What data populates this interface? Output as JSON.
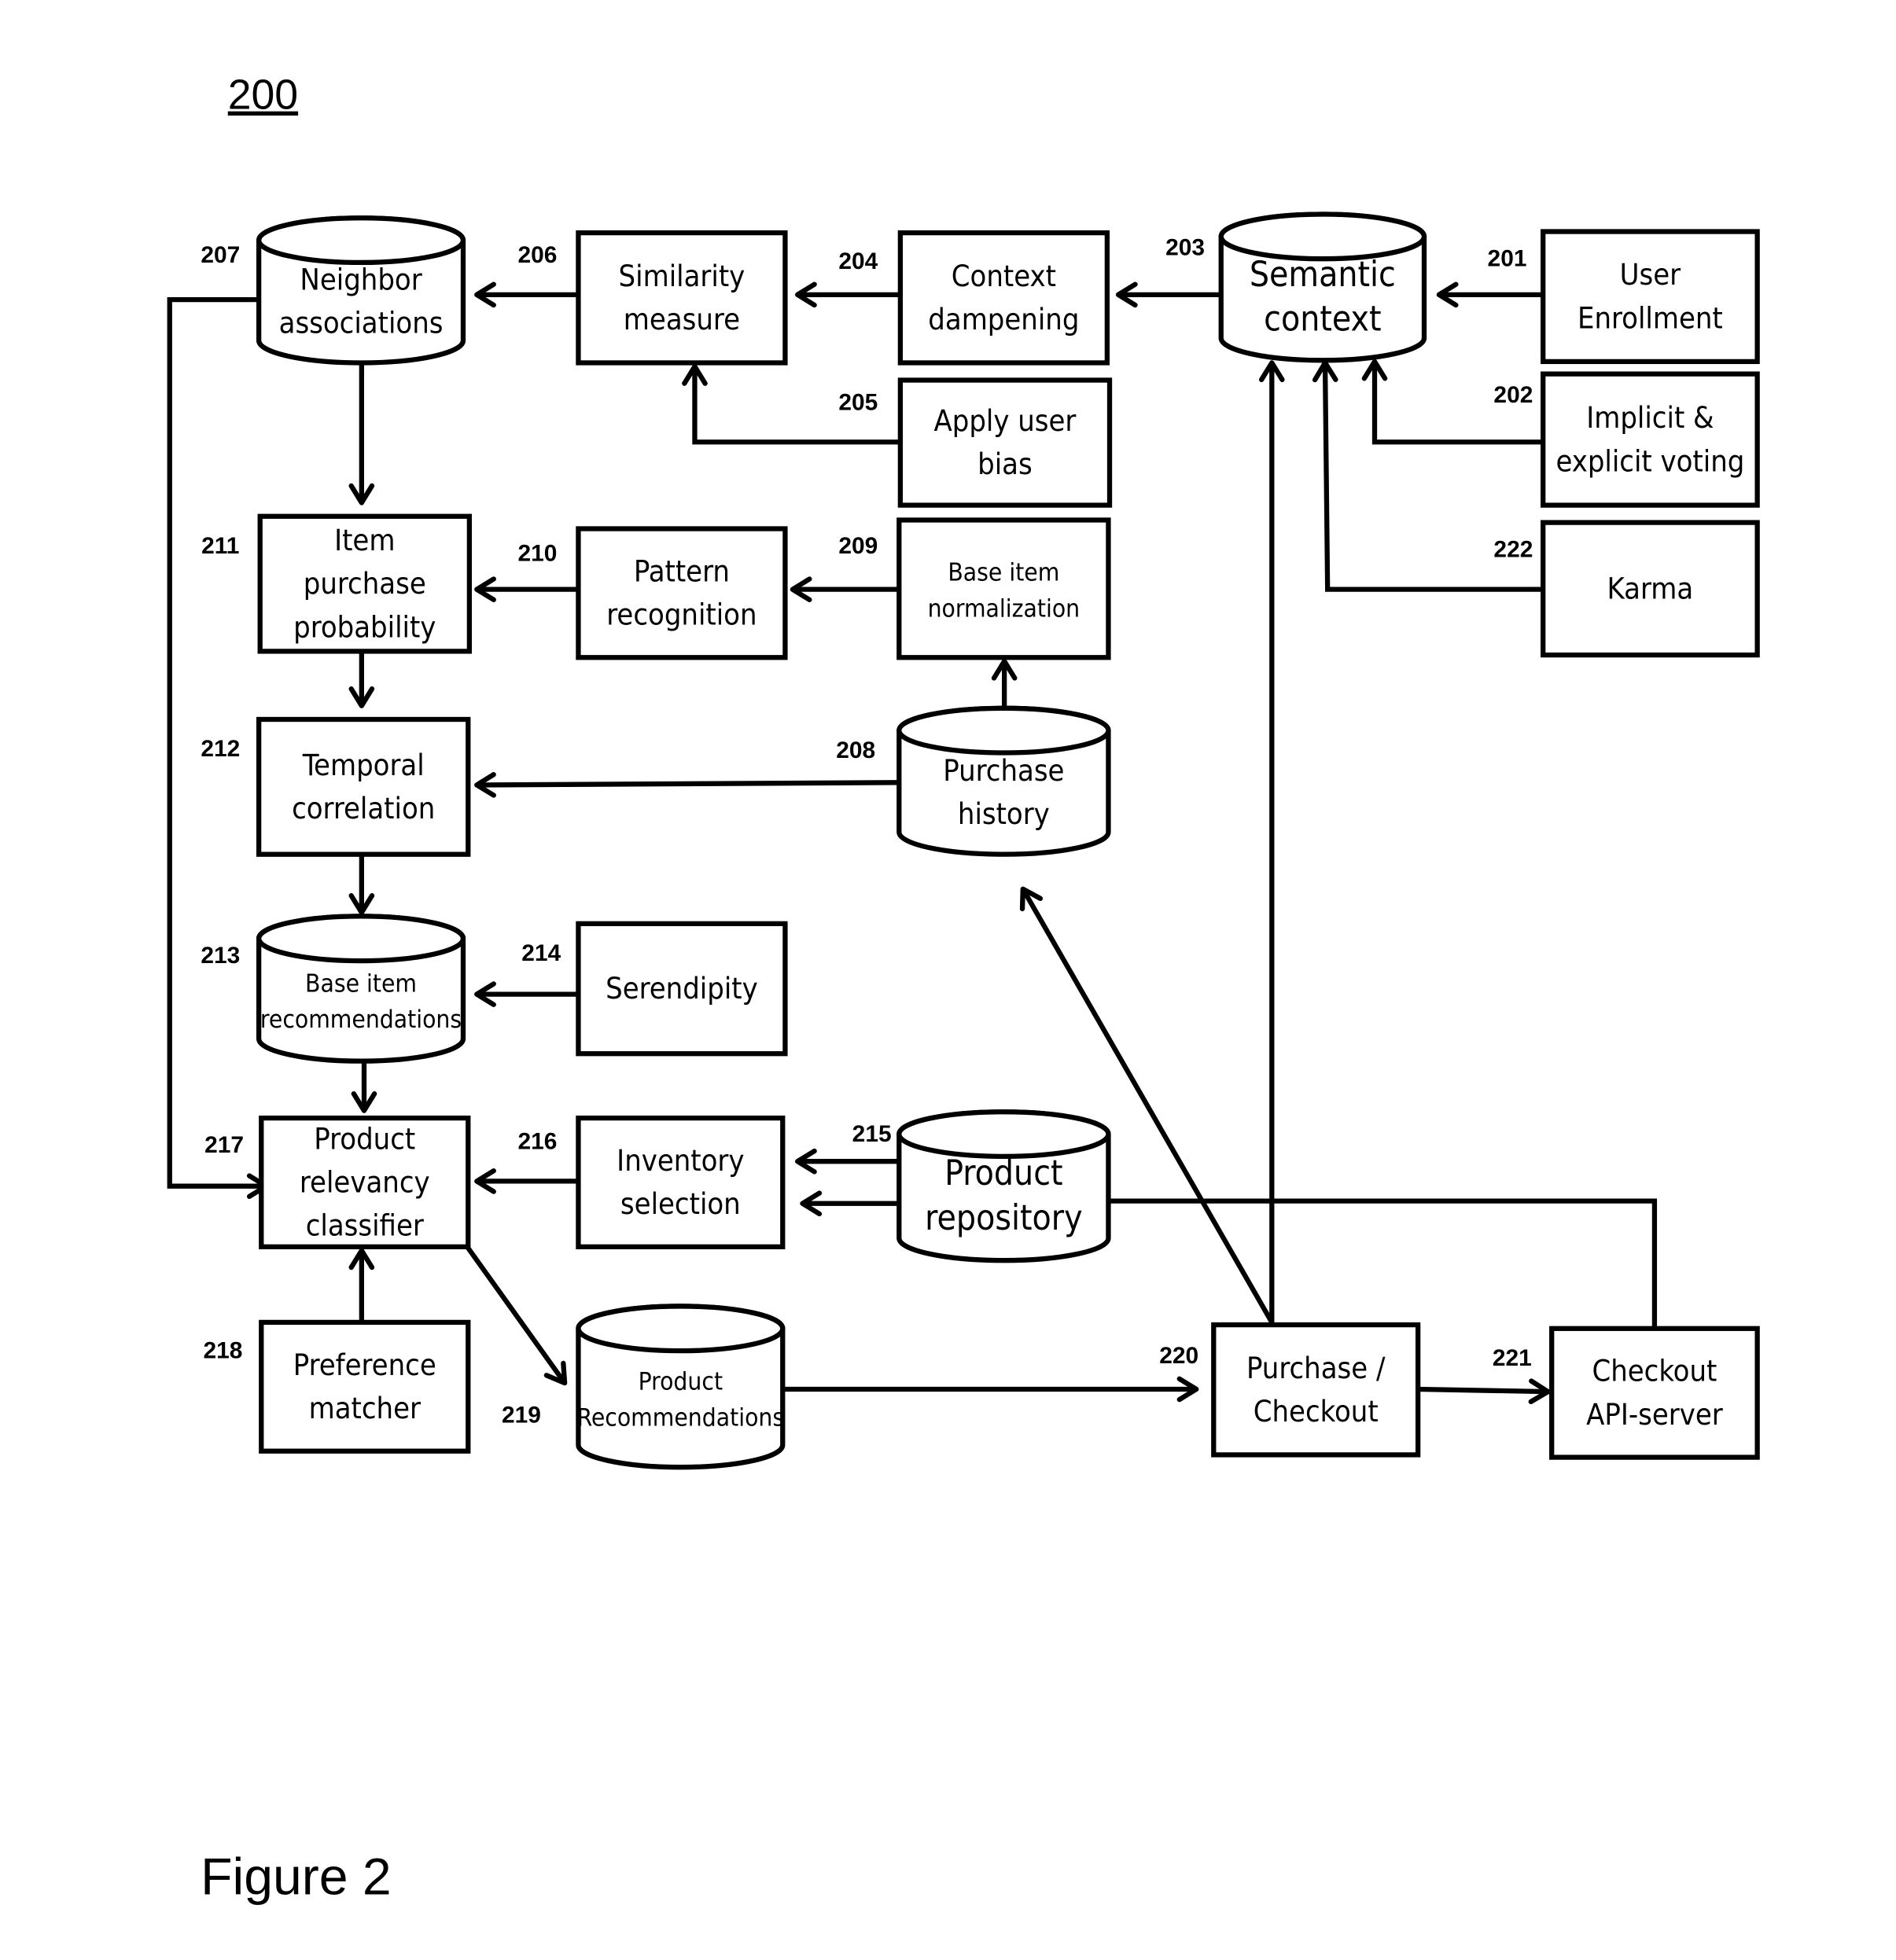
{
  "diagram": {
    "reference_number": "200",
    "figure_caption": "Figure 2",
    "nodes": {
      "n201": {
        "number": "201",
        "shape": "box",
        "lines": [
          "User",
          "Enrollment"
        ]
      },
      "n202": {
        "number": "202",
        "shape": "box",
        "lines": [
          "Implicit &",
          "explicit voting"
        ]
      },
      "n203": {
        "number": "203",
        "shape": "cylinder",
        "lines": [
          "Semantic",
          "context"
        ]
      },
      "n204": {
        "number": "204",
        "shape": "box",
        "lines": [
          "Context",
          "dampening"
        ]
      },
      "n205": {
        "number": "205",
        "shape": "box",
        "lines": [
          "Apply user",
          "bias"
        ]
      },
      "n206": {
        "number": "206",
        "shape": "box",
        "lines": [
          "Similarity",
          "measure"
        ]
      },
      "n207": {
        "number": "207",
        "shape": "cylinder",
        "lines": [
          "Neighbor",
          "associations"
        ]
      },
      "n208": {
        "number": "208",
        "shape": "cylinder",
        "lines": [
          "Purchase",
          "history"
        ]
      },
      "n209": {
        "number": "209",
        "shape": "box",
        "lines": [
          "Base item",
          "normalization"
        ]
      },
      "n210": {
        "number": "210",
        "shape": "box",
        "lines": [
          "Pattern",
          "recognition"
        ]
      },
      "n211": {
        "number": "211",
        "shape": "box",
        "lines": [
          "Item",
          "purchase",
          "probability"
        ]
      },
      "n212": {
        "number": "212",
        "shape": "box",
        "lines": [
          "Temporal",
          "correlation"
        ]
      },
      "n213": {
        "number": "213",
        "shape": "cylinder",
        "lines": [
          "Base item",
          "recommendations"
        ]
      },
      "n214": {
        "number": "214",
        "shape": "box",
        "lines": [
          "Serendipity"
        ]
      },
      "n215": {
        "number": "215",
        "shape": "cylinder",
        "lines": [
          "Product",
          "repository"
        ]
      },
      "n216": {
        "number": "216",
        "shape": "box",
        "lines": [
          "Inventory",
          "selection"
        ]
      },
      "n217": {
        "number": "217",
        "shape": "box",
        "lines": [
          "Product",
          "relevancy",
          "classifier"
        ]
      },
      "n218": {
        "number": "218",
        "shape": "box",
        "lines": [
          "Preference",
          "matcher"
        ]
      },
      "n219": {
        "number": "219",
        "shape": "cylinder",
        "lines": [
          "Product",
          "Recommendations"
        ]
      },
      "n220": {
        "number": "220",
        "shape": "box",
        "lines": [
          "Purchase /",
          "Checkout"
        ]
      },
      "n221": {
        "number": "221",
        "shape": "box",
        "lines": [
          "Checkout",
          "API-server"
        ]
      },
      "n222": {
        "number": "222",
        "shape": "box",
        "lines": [
          "Karma"
        ]
      }
    },
    "edges": [
      {
        "from": "201",
        "to": "203"
      },
      {
        "from": "202",
        "to": "203"
      },
      {
        "from": "222",
        "to": "203"
      },
      {
        "from": "220",
        "to": "203"
      },
      {
        "from": "203",
        "to": "204"
      },
      {
        "from": "204",
        "to": "206"
      },
      {
        "from": "205",
        "to": "206"
      },
      {
        "from": "206",
        "to": "207"
      },
      {
        "from": "207",
        "to": "211"
      },
      {
        "from": "207",
        "to": "217"
      },
      {
        "from": "208",
        "to": "209"
      },
      {
        "from": "208",
        "to": "212"
      },
      {
        "from": "209",
        "to": "210"
      },
      {
        "from": "210",
        "to": "211"
      },
      {
        "from": "211",
        "to": "212"
      },
      {
        "from": "212",
        "to": "213"
      },
      {
        "from": "214",
        "to": "213"
      },
      {
        "from": "213",
        "to": "217"
      },
      {
        "from": "215",
        "to": "216"
      },
      {
        "from": "221",
        "to": "216"
      },
      {
        "from": "216",
        "to": "217"
      },
      {
        "from": "218",
        "to": "217"
      },
      {
        "from": "217",
        "to": "219"
      },
      {
        "from": "219",
        "to": "220"
      },
      {
        "from": "220",
        "to": "208"
      },
      {
        "from": "220",
        "to": "221"
      }
    ]
  }
}
